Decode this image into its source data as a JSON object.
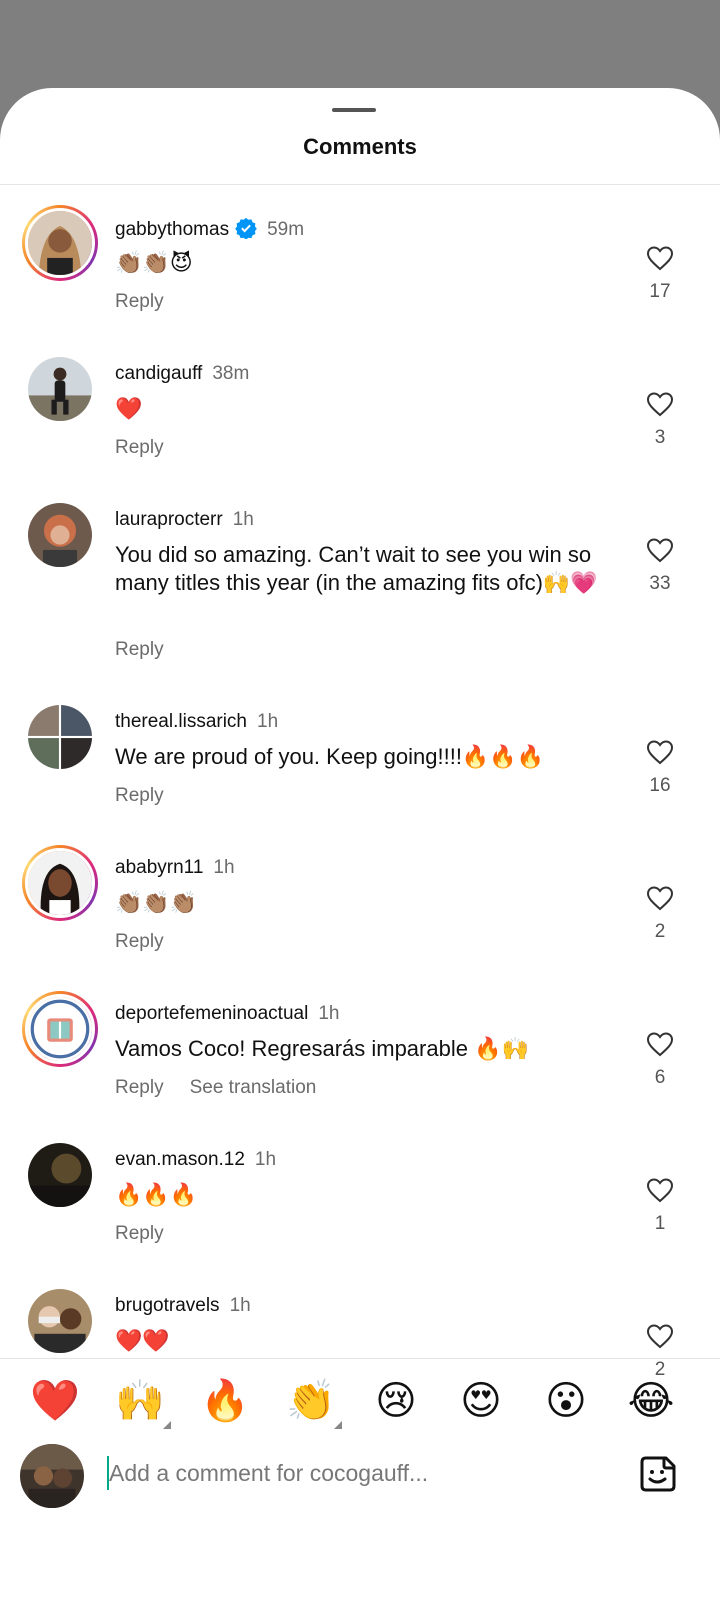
{
  "sheet": {
    "title": "Comments"
  },
  "comments": [
    {
      "username": "gabbythomas",
      "verified": true,
      "time": "59m",
      "text": "👏🏽👏🏽😈",
      "reply": "Reply",
      "likes": "17",
      "ring": true
    },
    {
      "username": "candigauff",
      "verified": false,
      "time": "38m",
      "text": "❤️",
      "reply": "Reply",
      "likes": "3",
      "ring": false
    },
    {
      "username": "lauraprocterr",
      "verified": false,
      "time": "1h",
      "text": "You did so amazing. Can’t wait to see you win so many titles this year (in the amazing fits ofc)🙌💗",
      "reply": "Reply",
      "likes": "33",
      "ring": false
    },
    {
      "username": "thereal.lissarich",
      "verified": false,
      "time": "1h",
      "text": "We are proud of you. Keep going!!!!🔥🔥🔥",
      "reply": "Reply",
      "likes": "16",
      "ring": false
    },
    {
      "username": "ababyrn11",
      "verified": false,
      "time": "1h",
      "text": "👏🏽👏🏽👏🏽",
      "reply": "Reply",
      "likes": "2",
      "ring": true
    },
    {
      "username": "deportefemeninoactual",
      "verified": false,
      "time": "1h",
      "text": "Vamos Coco! Regresarás imparable 🔥🙌",
      "reply": "Reply",
      "see_translation": "See translation",
      "likes": "6",
      "ring": true
    },
    {
      "username": "evan.mason.12",
      "verified": false,
      "time": "1h",
      "text": "🔥🔥🔥",
      "reply": "Reply",
      "likes": "1",
      "ring": false
    },
    {
      "username": "brugotravels",
      "verified": false,
      "time": "1h",
      "text": "❤️❤️",
      "likes": "2",
      "ring": false
    }
  ],
  "quick_reactions": [
    "❤️",
    "🙌",
    "🔥",
    "👏",
    "😢",
    "😍",
    "😮",
    "😂"
  ],
  "composer": {
    "placeholder": "Add a comment for cocogauff..."
  },
  "colors": {
    "verified": "#0095f6",
    "ring_start": "#f58529",
    "ring_end": "#dd2a7b"
  }
}
